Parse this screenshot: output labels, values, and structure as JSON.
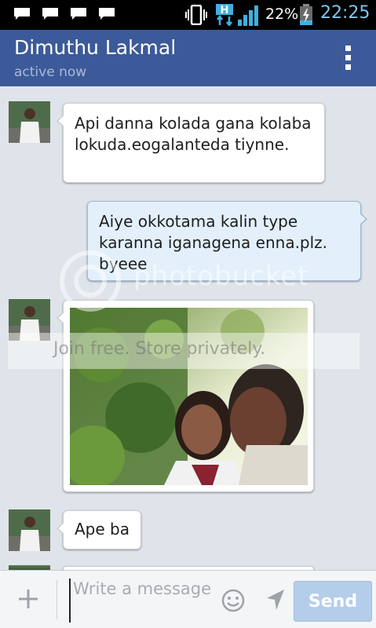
{
  "status_bar": {
    "battery_percent": "22%",
    "time": "22:25",
    "network_type": "H"
  },
  "header": {
    "contact_name": "Dimuthu Lakmal",
    "contact_status": "active now"
  },
  "messages": [
    {
      "direction": "incoming",
      "type": "text",
      "text": "Api danna kolada gana kolaba lokuda.eogalanteda tiynne."
    },
    {
      "direction": "outgoing",
      "type": "text",
      "text": "Aiye okkotama kalin type karanna iganagena enna.plz. byeee"
    },
    {
      "direction": "incoming",
      "type": "photo",
      "icon": "photo-thumbnail"
    },
    {
      "direction": "incoming",
      "type": "text",
      "text": "Ape ba"
    }
  ],
  "watermark": {
    "brand": "photobucket",
    "band_text": "Join free. Store privately."
  },
  "composer": {
    "placeholder": "Write a message",
    "send_label": "Send"
  },
  "colors": {
    "header_bg": "#3c5a99",
    "chat_bg": "#dfe3ea",
    "outgoing_bubble": "#e3f0fb",
    "send_button": "#b4cdea",
    "clock": "#7ec6f0"
  }
}
